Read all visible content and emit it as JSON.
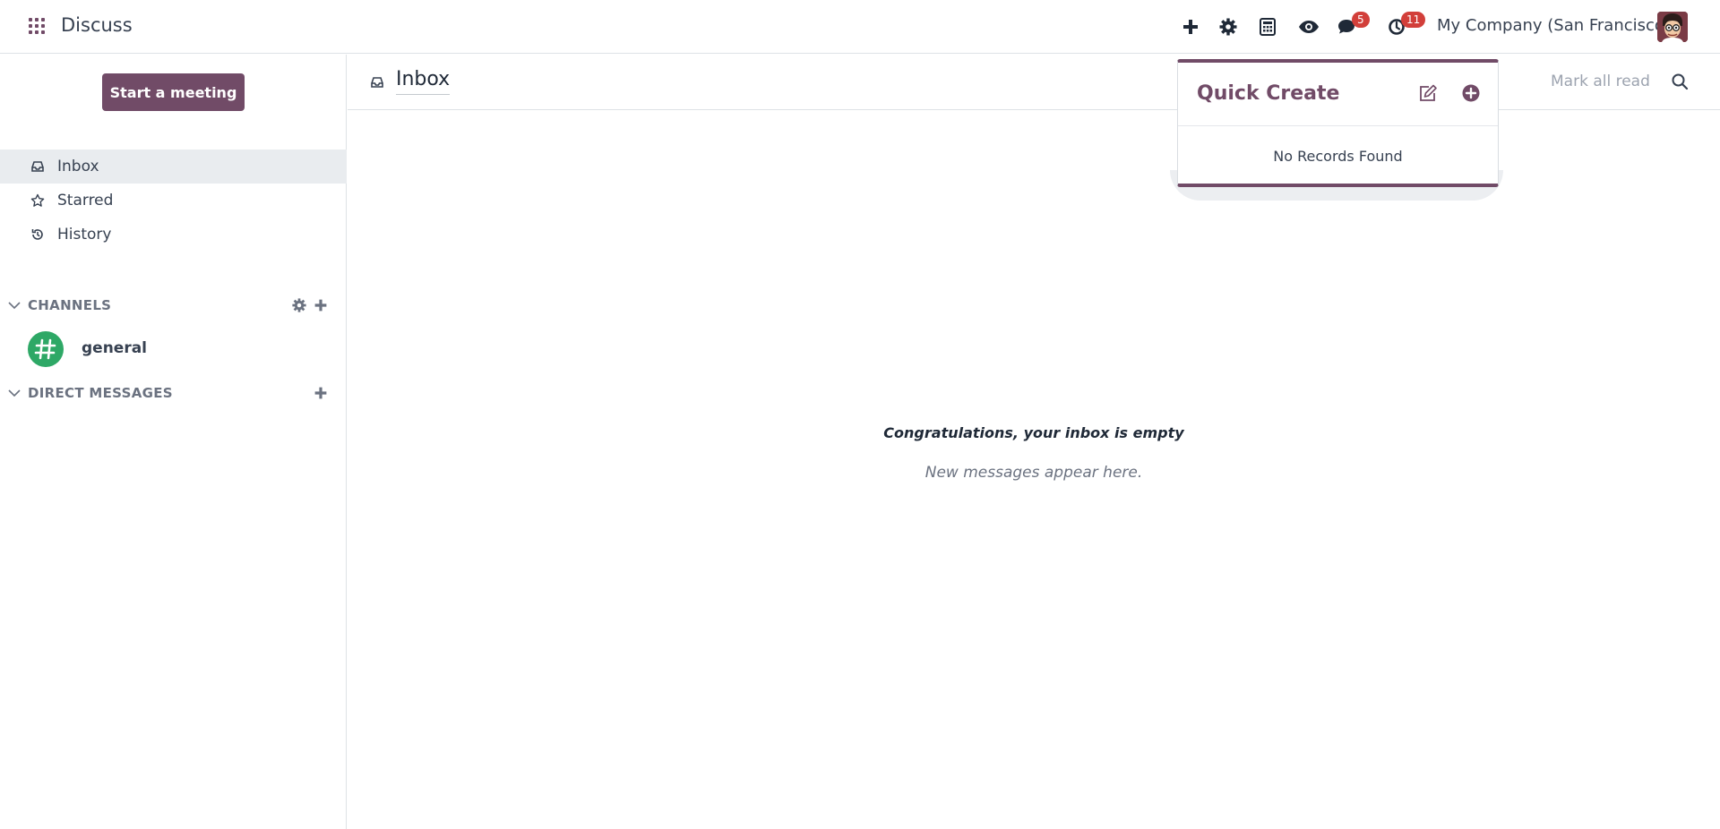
{
  "navbar": {
    "app_name": "Discuss",
    "messages_count": "5",
    "activities_count": "11",
    "company": "My Company (San Francisco)"
  },
  "sidebar": {
    "start_meeting": "Start a meeting",
    "items": [
      {
        "label": "Inbox",
        "icon": "inbox-icon",
        "active": true
      },
      {
        "label": "Starred",
        "icon": "star-icon",
        "active": false
      },
      {
        "label": "History",
        "icon": "history-icon",
        "active": false
      }
    ],
    "channels_header": "CHANNELS",
    "channels": [
      {
        "name": "general",
        "icon": "hash-icon",
        "color": "#2ea866"
      }
    ],
    "direct_messages_header": "DIRECT MESSAGES"
  },
  "main": {
    "title": "Inbox",
    "mark_all_read": "Mark all read",
    "empty_title": "Congratulations, your inbox is empty",
    "empty_subtitle": "New messages appear here."
  },
  "quick_create": {
    "title": "Quick Create",
    "empty_text": "No Records Found"
  },
  "colors": {
    "brand": "#714b67",
    "badge": "#d23f3a",
    "channel": "#2ea866"
  }
}
